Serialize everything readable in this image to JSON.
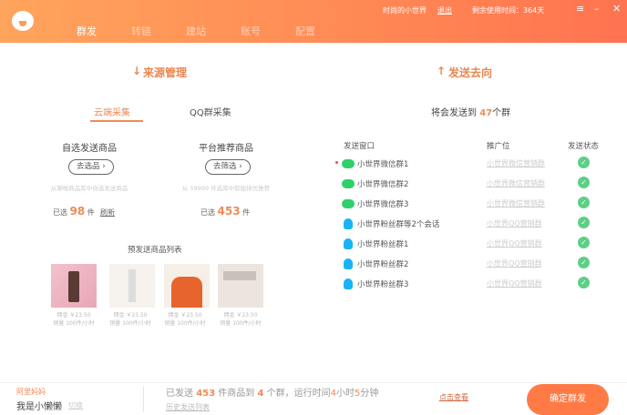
{
  "header": {
    "nav": [
      "群发",
      "转链",
      "建站",
      "账号",
      "配置"
    ],
    "user": "时尚的小世界",
    "logout": "退出",
    "remaining": "剩余使用时间：364天"
  },
  "source": {
    "title": "来源管理",
    "tabs": [
      "云端采集",
      "QQ群采集"
    ],
    "cols": [
      {
        "title": "自选发送商品",
        "button": "去选品",
        "desc": "从聊咖商品库中自选发送商品",
        "count_prefix": "已选",
        "count": "98",
        "count_suffix": "件",
        "extra": "刷新"
      },
      {
        "title": "平台推荐商品",
        "button": "去筛选",
        "desc": "从 59999 件选库中智能排优推荐",
        "count_prefix": "已选",
        "count": "453",
        "count_suffix": "件"
      }
    ],
    "list_title": "预发送商品列表",
    "products": [
      {
        "price": "佣金 ￥23.50",
        "sales": "销量 100件/小时"
      },
      {
        "price": "佣金 ￥23.50",
        "sales": "销量 100件/小时"
      },
      {
        "price": "佣金 ￥23.50",
        "sales": "销量 100件/小时"
      },
      {
        "price": "佣金 ￥23.50",
        "sales": "销量 100件/小时"
      }
    ]
  },
  "dest": {
    "title": "发送去向",
    "summary_prefix": "将会发送到",
    "summary_count": "47",
    "summary_suffix": "个群",
    "headers": [
      "发送窗口",
      "推广位",
      "发送状态"
    ],
    "rows": [
      {
        "type": "wechat",
        "name": "小世界微信群1",
        "slot": "小世界微信营销群"
      },
      {
        "type": "wechat",
        "name": "小世界微信群2",
        "slot": "小世界微信营销群"
      },
      {
        "type": "wechat",
        "name": "小世界微信群3",
        "slot": "小世界微信营销群"
      },
      {
        "type": "qq",
        "name": "小世界粉丝群等2个会话",
        "slot": "小世界QQ营销群"
      },
      {
        "type": "qq",
        "name": "小世界粉丝群1",
        "slot": "小世界QQ营销群"
      },
      {
        "type": "qq",
        "name": "小世界粉丝群2",
        "slot": "小世界QQ营销群"
      },
      {
        "type": "qq",
        "name": "小世界粉丝群3",
        "slot": "小世界QQ营销群"
      }
    ]
  },
  "footer": {
    "brand": "阿里妈妈",
    "user": "我是小懒懒",
    "switch": "切换",
    "s1": "已发送",
    "n1": "453",
    "s2": "件商品到",
    "n2": "4",
    "s3": "个群，运行时间",
    "h": "4",
    "s4": "小时",
    "m": "5",
    "s5": "分钟",
    "history": "历史发送列表",
    "view": "点击查看",
    "confirm": "确定群发"
  }
}
